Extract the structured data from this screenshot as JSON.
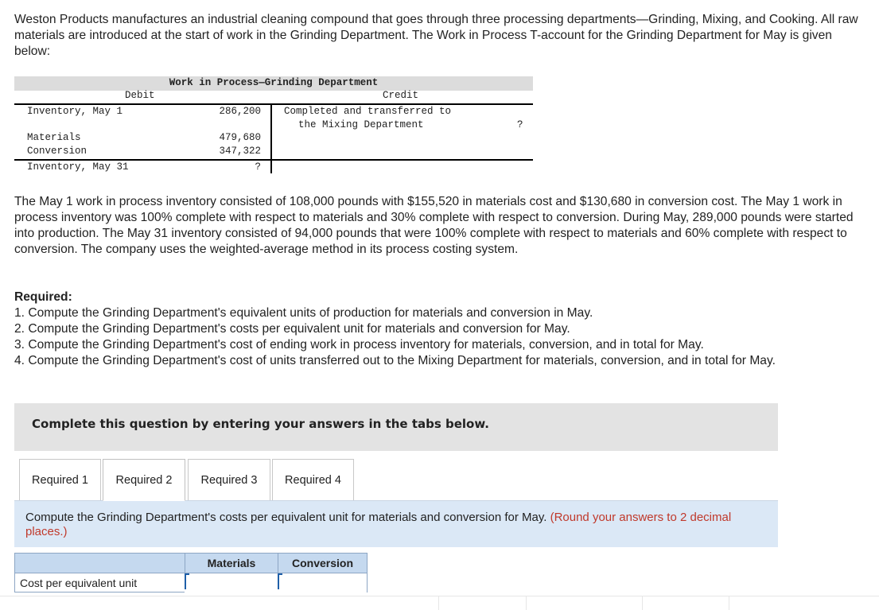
{
  "intro": "Weston Products manufactures an industrial cleaning compound that goes through three processing departments—Grinding, Mixing, and Cooking. All raw materials are introduced at the start of work in the Grinding Department. The Work in Process T-account for the Grinding Department for May is given below:",
  "taccount": {
    "title": "Work in Process—Grinding Department",
    "debit_label": "Debit",
    "credit_label": "Credit",
    "debit_rows": [
      {
        "label": "Inventory, May 1",
        "value": "286,200"
      },
      {
        "label": "Materials",
        "value": "479,680"
      },
      {
        "label": "Conversion",
        "value": "347,322"
      },
      {
        "label": "Inventory, May 31",
        "value": "?"
      }
    ],
    "credit_line1": "Completed and transferred to",
    "credit_line2": "the Mixing Department",
    "credit_value": "?"
  },
  "description": "The May 1 work in process inventory consisted of 108,000 pounds with $155,520 in materials cost and $130,680 in conversion cost. The May 1 work in process inventory was 100% complete with respect to materials and 30% complete with respect to conversion. During May, 289,000 pounds were started into production. The May 31 inventory consisted of 94,000 pounds that were 100% complete with respect to materials and 60% complete with respect to conversion. The company uses the weighted-average method in its process costing system.",
  "required": {
    "heading": "Required:",
    "items": [
      "1. Compute the Grinding Department's equivalent units of production for materials and conversion in May.",
      "2. Compute the Grinding Department's costs per equivalent unit for materials and conversion for May.",
      "3. Compute the Grinding Department's cost of ending work in process inventory for materials, conversion, and in total for May.",
      "4. Compute the Grinding Department's cost of units transferred out to the Mixing Department for materials, conversion, and in total for May."
    ]
  },
  "instruction": "Complete this question by entering your answers in the tabs below.",
  "tabs": [
    {
      "label": "Required 1",
      "active": false
    },
    {
      "label": "Required 2",
      "active": true
    },
    {
      "label": "Required 3",
      "active": false
    },
    {
      "label": "Required 4",
      "active": false
    }
  ],
  "panel": {
    "text": "Compute the Grinding Department's costs per equivalent unit for materials and conversion for May.",
    "note": "(Round your answers to 2 decimal places.)"
  },
  "answer_table": {
    "col_materials": "Materials",
    "col_conversion": "Conversion",
    "row_label": "Cost per equivalent unit",
    "materials_value": "",
    "conversion_value": ""
  },
  "colors": {
    "tab_panel_bg": "#dbe8f6",
    "header_bg": "#c5d9ef",
    "note_color": "#c0392b",
    "instruction_bg": "#e3e3e3"
  }
}
